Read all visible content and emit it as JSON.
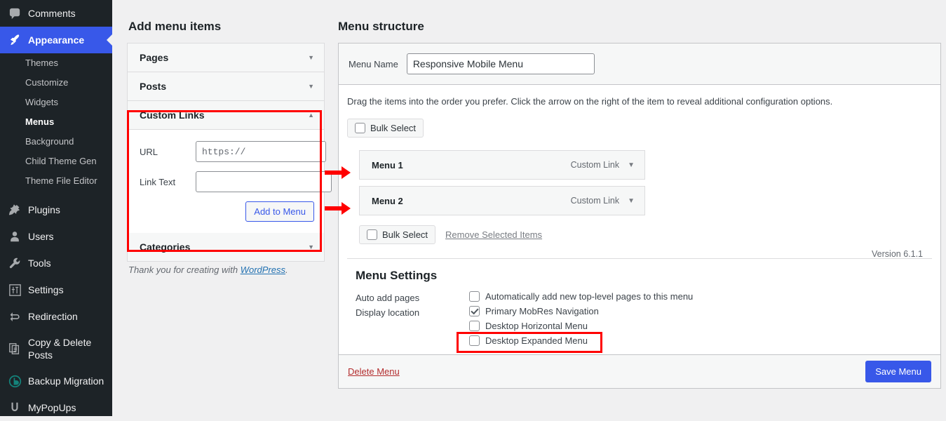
{
  "sidebar": {
    "items": [
      {
        "label": "Comments",
        "icon": "comments-icon",
        "current": false
      },
      {
        "label": "Appearance",
        "icon": "appearance-icon",
        "current": true
      },
      {
        "label": "Plugins",
        "icon": "plugins-icon",
        "current": false
      },
      {
        "label": "Users",
        "icon": "users-icon",
        "current": false
      },
      {
        "label": "Tools",
        "icon": "tools-icon",
        "current": false
      },
      {
        "label": "Settings",
        "icon": "settings-icon",
        "current": false
      },
      {
        "label": "Redirection",
        "icon": "redirection-icon",
        "current": false
      },
      {
        "label": "Copy & Delete Posts",
        "icon": "copy-delete-posts-icon",
        "current": false
      },
      {
        "label": "Backup Migration",
        "icon": "backup-migration-icon",
        "current": false
      },
      {
        "label": "MyPopUps",
        "icon": "mypopups-icon",
        "current": false
      }
    ],
    "appearance_submenu": [
      {
        "label": "Themes",
        "current": false
      },
      {
        "label": "Customize",
        "current": false
      },
      {
        "label": "Widgets",
        "current": false
      },
      {
        "label": "Menus",
        "current": true
      },
      {
        "label": "Background",
        "current": false
      },
      {
        "label": "Child Theme Gen",
        "current": false
      },
      {
        "label": "Theme File Editor",
        "current": false
      }
    ],
    "accent_color": "#3858e9",
    "background_color": "#1d2327"
  },
  "add_menu_items": {
    "title": "Add menu items",
    "panels": [
      {
        "label": "Pages",
        "state": "collapsed",
        "caret": "▼"
      },
      {
        "label": "Posts",
        "state": "collapsed",
        "caret": "▼"
      },
      {
        "label": "Custom Links",
        "state": "expanded",
        "caret": "▲"
      },
      {
        "label": "Categories",
        "state": "collapsed",
        "caret": "▼"
      }
    ],
    "custom_links": {
      "url_label": "URL",
      "url_value": "",
      "url_placeholder": "https://",
      "link_text_label": "Link Text",
      "link_text_value": "",
      "link_text_placeholder": "",
      "add_button": "Add to Menu"
    },
    "footer_text": "Thank you for creating with ",
    "footer_link": "WordPress",
    "footer_period": "."
  },
  "menu_structure": {
    "title": "Menu structure",
    "menu_name_label": "Menu Name",
    "menu_name_value": "Responsive Mobile Menu",
    "hint": "Drag the items into the order you prefer. Click the arrow on the right of the item to reveal additional configuration options.",
    "bulk_select_top": "Bulk Select",
    "bulk_select_bottom": "Bulk Select",
    "remove_selected": "Remove Selected Items",
    "items": [
      {
        "name": "Menu 1",
        "type": "Custom Link",
        "caret": "▼"
      },
      {
        "name": "Menu 2",
        "type": "Custom Link",
        "caret": "▼"
      }
    ],
    "version": "Version 6.1.1"
  },
  "menu_settings": {
    "title": "Menu Settings",
    "auto_add_label": "Auto add pages",
    "auto_add_option": "Automatically add new top-level pages to this menu",
    "auto_add_checked": false,
    "display_location_label": "Display location",
    "locations": [
      {
        "label": "Primary MobRes Navigation",
        "checked": true
      },
      {
        "label": "Desktop Horizontal Menu",
        "checked": false
      },
      {
        "label": "Desktop Expanded Menu",
        "checked": false
      }
    ]
  },
  "footer_actions": {
    "delete_menu": "Delete Menu",
    "save_menu": "Save Menu"
  },
  "annotations": {
    "highlight_color": "#ff0000",
    "boxes": [
      {
        "name": "custom-links-highlight"
      },
      {
        "name": "primary-navigation-highlight"
      }
    ],
    "arrows": [
      {
        "name": "arrow-to-menu-1"
      },
      {
        "name": "arrow-to-menu-2"
      }
    ]
  }
}
